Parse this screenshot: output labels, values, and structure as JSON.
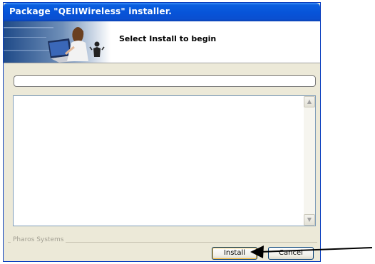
{
  "window": {
    "title": "Package \"QEIIWireless\" installer.",
    "colors": {
      "titlebar": "#0753d8",
      "face": "#ece9d8"
    }
  },
  "header": {
    "instruction": "Select Install to begin"
  },
  "progress": {
    "value": 0
  },
  "log": {
    "lines": []
  },
  "footer": {
    "group_label": "Pharos Systems",
    "install_label": "Install",
    "cancel_label": "Cancel"
  },
  "icons": {
    "scroll_up": "scroll-up-icon",
    "scroll_down": "scroll-down-icon",
    "callout": "arrow-icon"
  }
}
